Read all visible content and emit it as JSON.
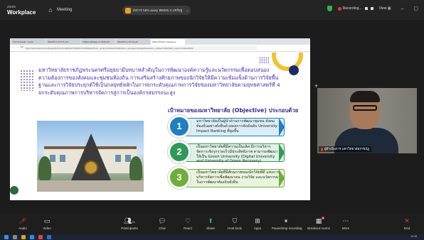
{
  "titlebar": {
    "brand_line1": "zoom",
    "brand_line2": "Workplace",
    "meeting_label": "Meeting",
    "share_title": "ผังการ บสถ.usasy ทดสอบ 2 แชร์อยู่",
    "recording_label": "Recording...",
    "view_label": "View"
  },
  "browser": {
    "tabs": [
      "Prof Schedule - Zoom",
      "ส่งเอกสาร 2 ตรวจ pdf",
      "Subject Manage IT 2019 pdf",
      "ส่งเอกสาร 2 ตรวจ pdf",
      "Slides Wisdom Resource"
    ],
    "url": "https://www.canva.com/design/DAG/xcr/ncEf/2L6TCMKJFIT/e/t4bEj/edit?utm_content=DAGeFmtKkk&utm_campaign=designshare&utm_medium=link2&utm_source=sharebutton"
  },
  "slide": {
    "paragraph": "มหาวิทยาลัยราชภัฏพระนครศรีอยุธยามีบทบาทสำคัญในการพัฒนาองค์ความรู้และนวัตกรรมเพื่อตอบสนองความต้องการของสังคมและชุมชนท้องถิ่น การเสริมสร้างศักยภาพของนักวิจัยให้มีความเข้มแข็งด้านการวิจัยพื้นฐานและการวิจัยประยุกต์ใช้เป็นกลยุทธ์หลักในการยกระดับคุณภาพการวิจัยของมหาวิทยาลัยตามยุทธศาสตร์ที่ 4 ยกระดับคุณภาพการบริหารจัดการสู่การเป็นองค์กรสมรรถนะสูง",
    "objective_title": "เป้าหมายของมหาวิทยาลัย (Objective) ประกอบด้วย",
    "objectives": [
      {
        "num": "1",
        "text": "มหาวิทยาลัยเป็นผู้นำด้านการพัฒนาชุมชน สังคม ท้องถิ่นอย่างยั่งยืนด้วยผลการจัดอันดับ University Impact Ranking ที่สูงขึ้น",
        "color": "#1f7fbf"
      },
      {
        "num": "2",
        "text": "เป็นมหาวิทยาลัยที่มีความเป็นเลิศ มีการบริหารจัดการเชิงรุกรวดเร็วมีประสิทธิภาพ สามารถพัฒนาให้เป็น Green University (Digital University and University of Green Recovery)",
        "color": "#2f9a57"
      },
      {
        "num": "3",
        "text": "เป็นมหาวิทยาลัยที่มีศักยภาพของนักวิจัยที่ดี แห่งการบริหารจัดการเพื่อพัฒนาคน งานวิจัย และนวัตกรรม ในการพัฒนาท้องถิ่นยั่งยืน",
        "color": "#6fae3a"
      }
    ]
  },
  "video": {
    "participant_name": "ผู้ดำเนินการ มหาวิทยาลัยราชภัฏ"
  },
  "toolbar": {
    "buttons": [
      {
        "label": "Audio",
        "icon": "microphone-muted-icon"
      },
      {
        "label": "Video",
        "icon": "video-icon"
      },
      {
        "label": "Participants",
        "icon": "participants-icon",
        "count": "31"
      },
      {
        "label": "Chat",
        "icon": "chat-icon"
      },
      {
        "label": "React",
        "icon": "heart-icon"
      },
      {
        "label": "Share",
        "icon": "share-screen-icon"
      },
      {
        "label": "Host tools",
        "icon": "shield-icon"
      },
      {
        "label": "Apps",
        "icon": "apps-icon"
      },
      {
        "label": "Pause/stop recording",
        "icon": "pause-recording-icon"
      },
      {
        "label": "Breakout rooms",
        "icon": "breakout-rooms-icon"
      },
      {
        "label": "More",
        "icon": "more-icon"
      },
      {
        "label": "End",
        "icon": "close-icon"
      }
    ]
  },
  "taskbar": {
    "clock": "10:18"
  },
  "colors": {
    "accent_purple": "#4b2fa0",
    "gold": "#f2c12e",
    "zoom_green": "#2fb34a",
    "record_red": "#e53935"
  }
}
